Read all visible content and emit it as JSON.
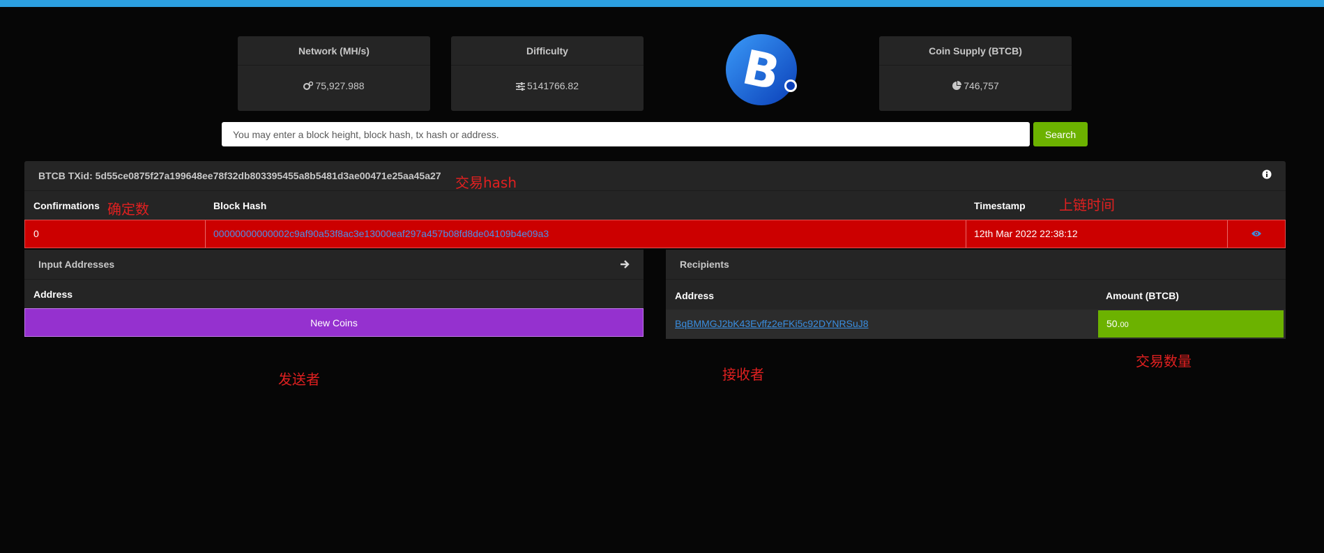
{
  "stats": [
    {
      "title": "Network (MH/s)",
      "value": "75,927.988",
      "icon": "gears-icon"
    },
    {
      "title": "Difficulty",
      "value": "5141766.82",
      "icon": "sliders-icon"
    },
    {
      "title": "Coin Supply (BTCB)",
      "value": "746,757",
      "icon": "pie-chart-icon"
    }
  ],
  "logo": {
    "icon": "bitcoin-logo",
    "glyph": "B",
    "color": "#1a74e8"
  },
  "search": {
    "placeholder": "You may enter a block height, block hash, tx hash or address.",
    "button": "Search"
  },
  "tx": {
    "header": "BTCB TXid: 5d55ce0875f27a199648ee78f32db803395455a8b5481d3ae00471e25aa45a27",
    "columns": {
      "confirmations": "Confirmations",
      "block_hash": "Block Hash",
      "timestamp": "Timestamp"
    },
    "row": {
      "confirmations": "0",
      "block_hash": "00000000000002c9af90a53f8ac3e13000eaf297a457b08fd8de04109b4e09a3",
      "timestamp": "12th Mar 2022 22:38:12"
    }
  },
  "inputs": {
    "title": "Input Addresses",
    "col_address": "Address",
    "row": "New Coins"
  },
  "recipients": {
    "title": "Recipients",
    "col_address": "Address",
    "col_amount": "Amount (BTCB)",
    "rows": [
      {
        "address": "BqBMMGJ2bK43Evffz2eFKi5c92DYNRSuJ8",
        "amount_int": "50.",
        "amount_dec": "00"
      }
    ]
  },
  "annotations": {
    "tx_hash": "交易hash",
    "confirmations": "确定数",
    "timestamp": "上链时间",
    "sender": "发送者",
    "receiver": "接收者",
    "amount": "交易数量"
  },
  "colors": {
    "accent_bar": "#2c9fe0",
    "danger_row": "#cc0000",
    "success": "#6cb200",
    "new_coins": "#9531cf",
    "annotation": "#e02020"
  }
}
